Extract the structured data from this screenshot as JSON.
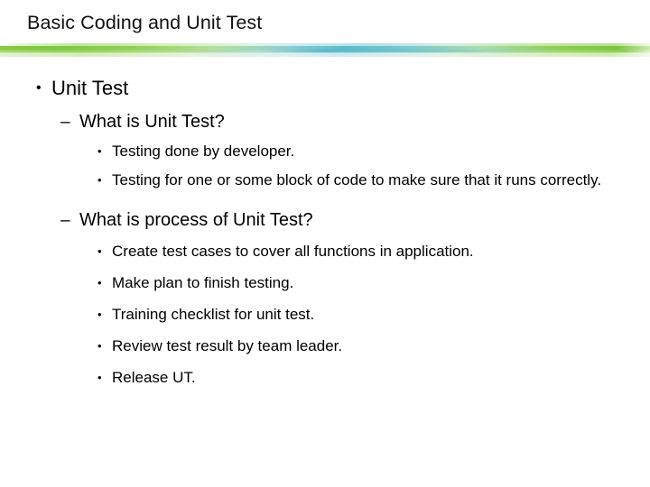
{
  "slide": {
    "title": "Basic Coding and Unit Test",
    "accent_colors": {
      "green": "#8cc63f",
      "teal": "#4fb3c4",
      "light_green": "#b6e08c",
      "light_teal": "#bde4ec"
    },
    "background": "#ffffff",
    "text_color": "#000000"
  },
  "outline": {
    "level1": {
      "marker": "•",
      "text": "Unit Test"
    },
    "sections": [
      {
        "marker": "–",
        "heading": "What is Unit Test?",
        "bullet_marker": "•",
        "items": [
          "Testing done by developer.",
          "Testing for one or some block of code to make sure that it runs correctly."
        ]
      },
      {
        "marker": "–",
        "heading": "What is process of Unit Test?",
        "bullet_marker": "•",
        "items": [
          "Create test cases to cover all functions in application.",
          "Make plan to finish testing.",
          "Training checklist for unit test.",
          "Review test result by team leader.",
          "Release UT."
        ]
      }
    ]
  }
}
